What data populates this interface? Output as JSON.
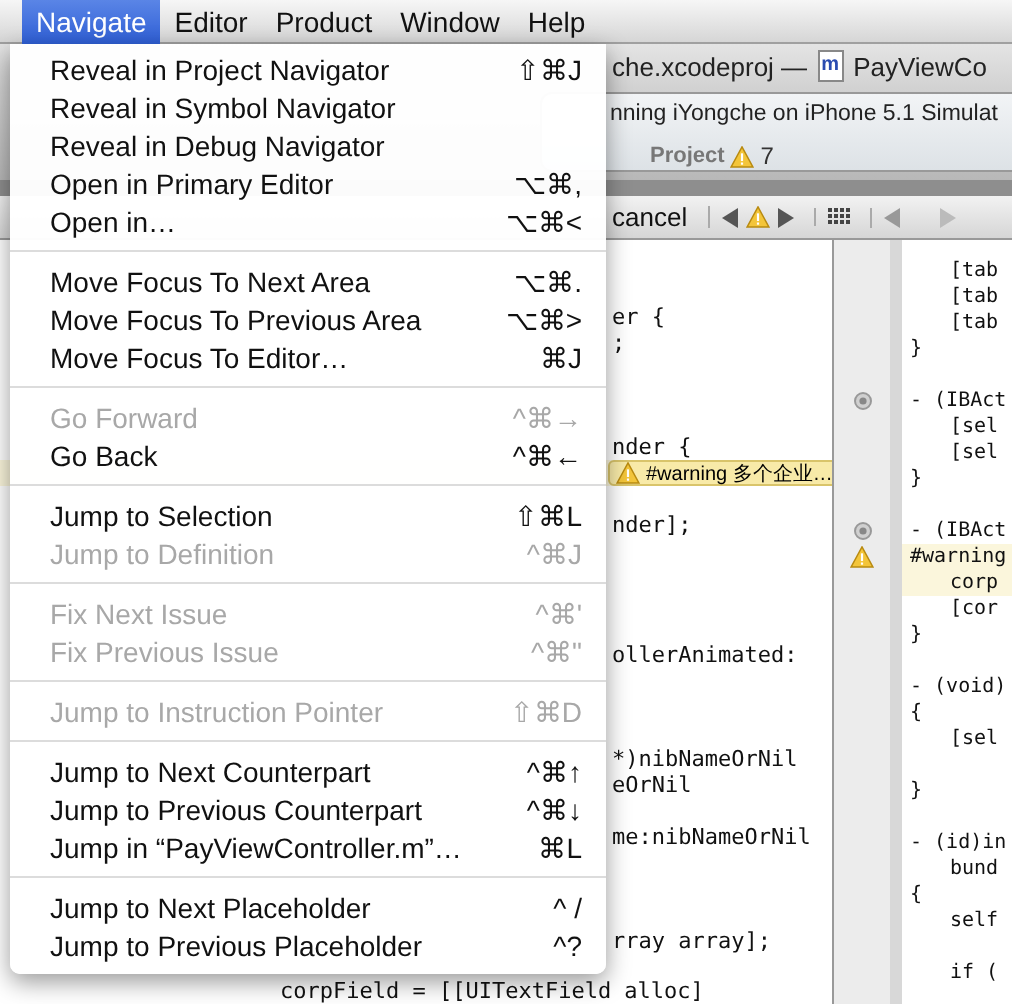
{
  "menu_bar": [
    {
      "label": "Navigate",
      "selected": true
    },
    {
      "label": "Editor",
      "selected": false
    },
    {
      "label": "Product",
      "selected": false
    },
    {
      "label": "Window",
      "selected": false
    },
    {
      "label": "Help",
      "selected": false
    }
  ],
  "window": {
    "title": "che.xcodeproj —",
    "file_icon": "m",
    "file_name": "PayViewCo"
  },
  "activity": {
    "status": "nning iYongche on iPhone 5.1 Simulat",
    "issues_label": "Project",
    "warning_count": "7"
  },
  "jump_bar": {
    "item": "cancel"
  },
  "left_editor": {
    "lines": [
      {
        "kind": "blank"
      },
      {
        "kind": "blank"
      },
      {
        "kind": "partial",
        "text": "er {"
      },
      {
        "kind": "partial",
        "text": ";"
      },
      {
        "kind": "blank"
      },
      {
        "kind": "blank"
      },
      {
        "kind": "blank"
      },
      {
        "kind": "partial",
        "text": "nder {"
      },
      {
        "kind": "warning",
        "text": "#warning 多个企业…"
      },
      {
        "kind": "blank"
      },
      {
        "kind": "partial",
        "text": "nder];"
      },
      {
        "kind": "blank"
      },
      {
        "kind": "blank"
      },
      {
        "kind": "blank"
      },
      {
        "kind": "blank"
      },
      {
        "kind": "partial",
        "text": "ollerAnimated:"
      },
      {
        "kind": "blank"
      },
      {
        "kind": "blank"
      },
      {
        "kind": "blank"
      },
      {
        "kind": "partial",
        "text": "*)nibNameOrNil"
      },
      {
        "kind": "partial",
        "text": "eOrNil"
      },
      {
        "kind": "blank"
      },
      {
        "kind": "partial",
        "text": "me:nibNameOrNil"
      },
      {
        "kind": "blank"
      },
      {
        "kind": "blank"
      },
      {
        "kind": "blank"
      },
      {
        "kind": "partial",
        "text": "rray array];"
      },
      {
        "kind": "blank"
      },
      {
        "kind": "full",
        "text": "corpField = [[UITextField alloc]"
      }
    ]
  },
  "right_editor": {
    "lines": [
      {
        "kind": "indented",
        "text": "[tab",
        "breakpoint": false,
        "issue": false,
        "highlighted": false
      },
      {
        "kind": "indented",
        "text": "[tab",
        "breakpoint": false,
        "issue": false,
        "highlighted": false
      },
      {
        "kind": "indented",
        "text": "[tab",
        "breakpoint": false,
        "issue": false,
        "highlighted": false
      },
      {
        "kind": "code",
        "text": "}",
        "breakpoint": false,
        "issue": false,
        "highlighted": false
      },
      {
        "kind": "blank",
        "breakpoint": false,
        "issue": false,
        "highlighted": false
      },
      {
        "kind": "code",
        "text": "- (IBAct",
        "breakpoint": true,
        "issue": false,
        "highlighted": false
      },
      {
        "kind": "indented",
        "text": "[sel",
        "breakpoint": false,
        "issue": false,
        "highlighted": false
      },
      {
        "kind": "indented",
        "text": "[sel",
        "breakpoint": false,
        "issue": false,
        "highlighted": false
      },
      {
        "kind": "code",
        "text": "}",
        "breakpoint": false,
        "issue": false,
        "highlighted": false
      },
      {
        "kind": "blank",
        "breakpoint": false,
        "issue": false,
        "highlighted": false
      },
      {
        "kind": "code",
        "text": "- (IBAct",
        "breakpoint": true,
        "issue": false,
        "highlighted": false
      },
      {
        "kind": "code",
        "text": "#warning",
        "breakpoint": false,
        "issue": true,
        "highlighted": true
      },
      {
        "kind": "indented",
        "text": "corp",
        "breakpoint": false,
        "issue": false,
        "highlighted": true
      },
      {
        "kind": "indented",
        "text": "[cor",
        "breakpoint": false,
        "issue": false,
        "highlighted": false
      },
      {
        "kind": "code",
        "text": "}",
        "breakpoint": false,
        "issue": false,
        "highlighted": false
      },
      {
        "kind": "blank",
        "breakpoint": false,
        "issue": false,
        "highlighted": false
      },
      {
        "kind": "code",
        "text": "- (void)",
        "breakpoint": false,
        "issue": false,
        "highlighted": false
      },
      {
        "kind": "code",
        "text": "{",
        "breakpoint": false,
        "issue": false,
        "highlighted": false
      },
      {
        "kind": "indented",
        "text": "[sel",
        "breakpoint": false,
        "issue": false,
        "highlighted": false
      },
      {
        "kind": "blank",
        "breakpoint": false,
        "issue": false,
        "highlighted": false
      },
      {
        "kind": "code",
        "text": "}",
        "breakpoint": false,
        "issue": false,
        "highlighted": false
      },
      {
        "kind": "blank",
        "breakpoint": false,
        "issue": false,
        "highlighted": false
      },
      {
        "kind": "code",
        "text": "- (id)in",
        "breakpoint": false,
        "issue": false,
        "highlighted": false
      },
      {
        "kind": "indented",
        "text": "bund",
        "breakpoint": false,
        "issue": false,
        "highlighted": false
      },
      {
        "kind": "code",
        "text": "{",
        "breakpoint": false,
        "issue": false,
        "highlighted": false
      },
      {
        "kind": "indented",
        "text": "self",
        "breakpoint": false,
        "issue": false,
        "highlighted": false
      },
      {
        "kind": "blank",
        "breakpoint": false,
        "issue": false,
        "highlighted": false
      },
      {
        "kind": "indented",
        "text": "if (",
        "breakpoint": false,
        "issue": false,
        "highlighted": false
      }
    ]
  },
  "navigate_menu": {
    "groups": [
      [
        {
          "label": "Reveal in Project Navigator",
          "shortcut": "⇧⌘J",
          "disabled": false
        },
        {
          "label": "Reveal in Symbol Navigator",
          "disabled": false
        },
        {
          "label": "Reveal in Debug Navigator",
          "disabled": false
        },
        {
          "label": "Open in Primary Editor",
          "shortcut": "⌥⌘,",
          "disabled": false
        },
        {
          "label": "Open in…",
          "shortcut": "⌥⌘<",
          "disabled": false
        }
      ],
      [
        {
          "label": "Move Focus To Next Area",
          "shortcut": "⌥⌘.",
          "disabled": false
        },
        {
          "label": "Move Focus To Previous Area",
          "shortcut": "⌥⌘>",
          "disabled": false
        },
        {
          "label": "Move Focus To Editor…",
          "shortcut": "⌘J",
          "disabled": false
        }
      ],
      [
        {
          "label": "Go Forward",
          "shortcut": "^⌘→",
          "disabled": true
        },
        {
          "label": "Go Back",
          "shortcut": "^⌘←",
          "disabled": false
        }
      ],
      [
        {
          "label": "Jump to Selection",
          "shortcut": "⇧⌘L",
          "disabled": false
        },
        {
          "label": "Jump to Definition",
          "shortcut": "^⌘J",
          "disabled": true
        }
      ],
      [
        {
          "label": "Fix Next Issue",
          "shortcut": "^⌘'",
          "disabled": true
        },
        {
          "label": "Fix Previous Issue",
          "shortcut": "^⌘\"",
          "disabled": true
        }
      ],
      [
        {
          "label": "Jump to Instruction Pointer",
          "shortcut": "⇧⌘D",
          "disabled": true
        }
      ],
      [
        {
          "label": "Jump to Next Counterpart",
          "shortcut": "^⌘↑",
          "disabled": false
        },
        {
          "label": "Jump to Previous Counterpart",
          "shortcut": "^⌘↓",
          "disabled": false
        },
        {
          "label": "Jump in “PayViewController.m”…",
          "shortcut": "⌘L",
          "disabled": false
        }
      ],
      [
        {
          "label": "Jump to Next Placeholder",
          "shortcut": "^ /",
          "disabled": false
        },
        {
          "label": "Jump to Previous Placeholder",
          "shortcut": "^?",
          "disabled": false
        }
      ]
    ]
  }
}
